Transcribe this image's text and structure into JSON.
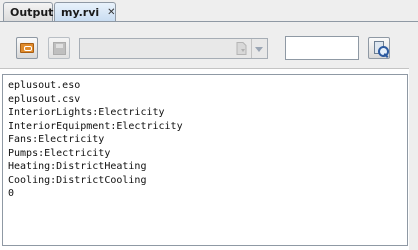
{
  "tabs": [
    {
      "label": "Output"
    },
    {
      "label": "my.rvi",
      "close_symbol": "✕"
    }
  ],
  "toolbar": {
    "open_icon": "folder-open-icon",
    "save_icon": "save-disk-icon",
    "combo_value": "",
    "search_value": "",
    "search_icon": "search-icon"
  },
  "content": {
    "lines": [
      "eplusout.eso",
      "eplusout.csv",
      "InteriorLights:Electricity",
      "InteriorEquipment:Electricity",
      "Fans:Electricity",
      "Pumps:Electricity",
      "Heating:DistrictHeating",
      "Cooling:DistrictCooling",
      "0"
    ]
  },
  "colors": {
    "chrome": "#eeeeee",
    "active_tab": "#c9ddf2",
    "border": "#8f99a4",
    "accent_orange": "#e08a2a",
    "accent_blue": "#2c5aa0"
  }
}
